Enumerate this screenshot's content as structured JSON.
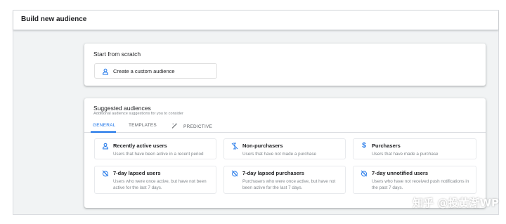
{
  "header": {
    "title": "Build new audience"
  },
  "scratch": {
    "title": "Start from scratch",
    "custom_label": "Create a custom audience",
    "custom_icon": "person-icon"
  },
  "suggested": {
    "title": "Suggested audiences",
    "subtitle": "Additional audience suggestions for you to consider",
    "tabs": [
      {
        "label": "GENERAL",
        "active": true
      },
      {
        "label": "TEMPLATES",
        "active": false
      },
      {
        "label": "PREDICTIVE",
        "active": false,
        "icon": "magic-wand-icon"
      }
    ],
    "tiles": [
      {
        "icon": "person-icon",
        "title": "Recently active users",
        "desc": "Users that have been active in a recent period"
      },
      {
        "icon": "no-purchase-icon",
        "title": "Non-purchasers",
        "desc": "Users that have not made a purchase"
      },
      {
        "icon": "dollar-icon",
        "title": "Purchasers",
        "desc": "Users that have made a purchase"
      },
      {
        "icon": "lapsed-icon",
        "title": "7-day lapsed users",
        "desc": "Users who were once active, but have not been active for the last 7 days."
      },
      {
        "icon": "lapsed-icon",
        "title": "7-day lapsed purchasers",
        "desc": "Purchasers who were once active, but have not been active for the last 7 days."
      },
      {
        "icon": "lapsed-icon",
        "title": "7-day unnotified users",
        "desc": "Users who have not received push notifications in the past 7 days."
      }
    ]
  },
  "watermark": "知乎 @投黄渐WP",
  "colors": {
    "accent": "#1a73e8",
    "muted": "#80868b",
    "background": "#f1f3f4"
  }
}
